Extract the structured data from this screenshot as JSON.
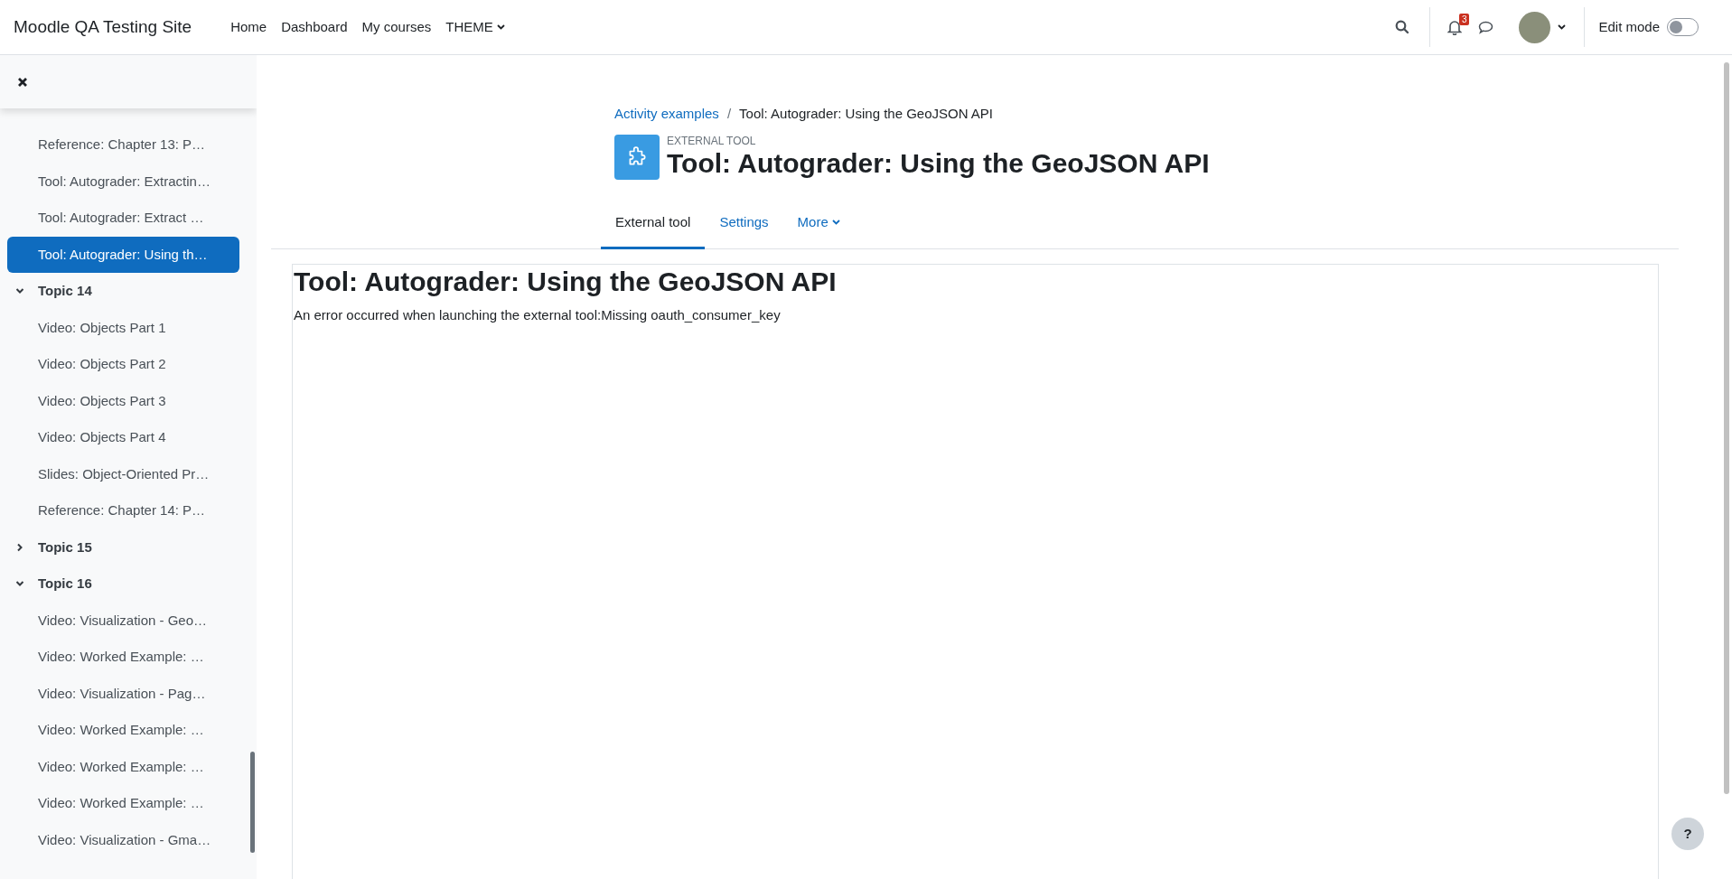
{
  "navbar": {
    "site_name": "Moodle QA Testing Site",
    "links": [
      {
        "label": "Home",
        "dropdown": false
      },
      {
        "label": "Dashboard",
        "dropdown": false
      },
      {
        "label": "My courses",
        "dropdown": false
      },
      {
        "label": "THEME",
        "dropdown": true
      }
    ],
    "notification_count": "3",
    "edit_mode": {
      "label": "Edit mode",
      "on": false
    }
  },
  "sidebar": {
    "items": [
      {
        "kind": "activity",
        "label": "Reference: Chapter 13: P…",
        "selected": false
      },
      {
        "kind": "activity",
        "label": "Tool: Autograder: Extractin…",
        "selected": false
      },
      {
        "kind": "activity",
        "label": "Tool: Autograder: Extract …",
        "selected": false
      },
      {
        "kind": "activity",
        "label": "Tool: Autograder: Using th…",
        "selected": true
      },
      {
        "kind": "section",
        "label": "Topic 14",
        "expanded": true,
        "children": [
          {
            "kind": "activity",
            "label": "Video: Objects Part 1",
            "selected": false
          },
          {
            "kind": "activity",
            "label": "Video: Objects Part 2",
            "selected": false
          },
          {
            "kind": "activity",
            "label": "Video: Objects Part 3",
            "selected": false
          },
          {
            "kind": "activity",
            "label": "Video: Objects Part 4",
            "selected": false
          },
          {
            "kind": "activity",
            "label": "Slides: Object-Oriented Pr…",
            "selected": false
          },
          {
            "kind": "activity",
            "label": "Reference: Chapter 14: P…",
            "selected": false
          }
        ]
      },
      {
        "kind": "section",
        "label": "Topic 15",
        "expanded": false
      },
      {
        "kind": "section",
        "label": "Topic 16",
        "expanded": true,
        "children": [
          {
            "kind": "activity",
            "label": "Video: Visualization - Geo…",
            "selected": false
          },
          {
            "kind": "activity",
            "label": "Video: Worked Example: …",
            "selected": false
          },
          {
            "kind": "activity",
            "label": "Video: Visualization - Pag…",
            "selected": false
          },
          {
            "kind": "activity",
            "label": "Video: Worked Example: …",
            "selected": false
          },
          {
            "kind": "activity",
            "label": "Video: Worked Example: …",
            "selected": false
          },
          {
            "kind": "activity",
            "label": "Video: Worked Example: …",
            "selected": false
          },
          {
            "kind": "activity",
            "label": "Video: Visualization - Gma…",
            "selected": false
          }
        ]
      }
    ]
  },
  "breadcrumb": [
    {
      "kind": "link",
      "label": "Activity examples"
    },
    {
      "kind": "separator",
      "label": "/"
    },
    {
      "kind": "current",
      "label": "Tool: Autograder: Using the GeoJSON API"
    }
  ],
  "header": {
    "kind_label": "EXTERNAL TOOL",
    "title": "Tool: Autograder: Using the GeoJSON API"
  },
  "tabs": [
    {
      "label": "External tool",
      "selected": true,
      "dropdown": false
    },
    {
      "label": "Settings",
      "selected": false,
      "dropdown": false
    },
    {
      "label": "More",
      "selected": false,
      "dropdown": true
    }
  ],
  "frame": {
    "heading": "Tool: Autograder: Using the GeoJSON API",
    "message": "An error occurred when launching the external tool:Missing oauth_consumer_key"
  },
  "help_button": "?"
}
